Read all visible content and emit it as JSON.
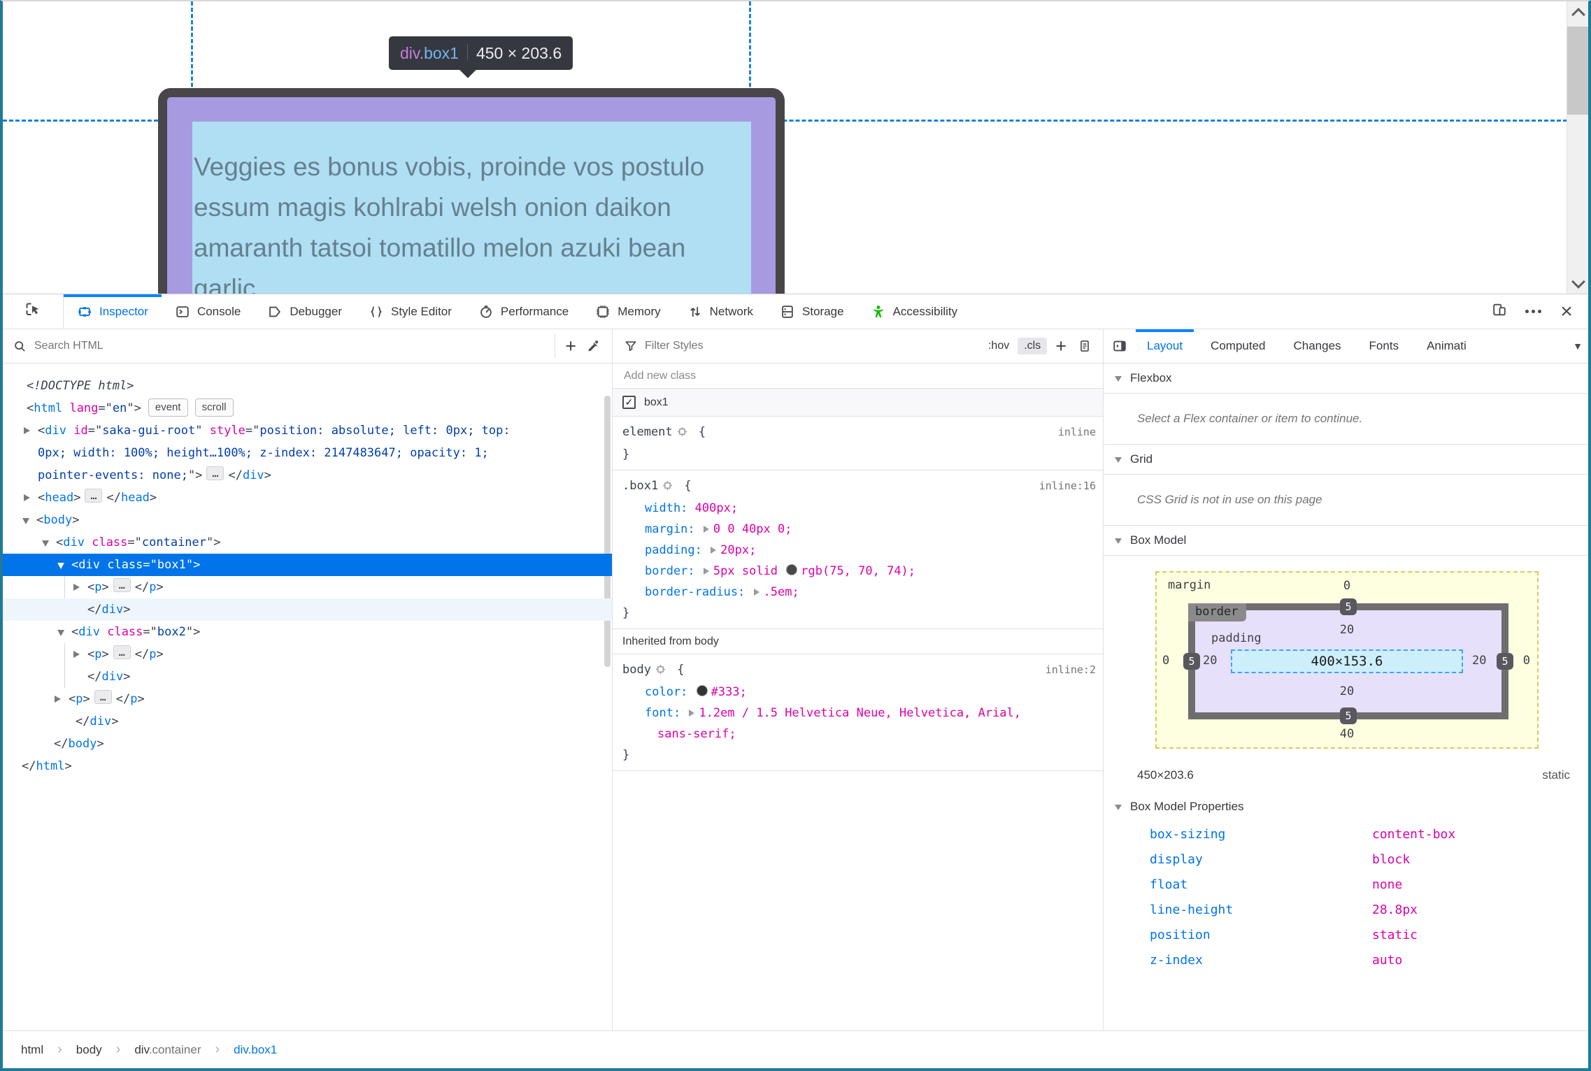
{
  "colors": {
    "accent": "#0074e8",
    "tab_indicator": "#0a84ff",
    "selection": "#0074e8",
    "accessibility_green": "#12bc00",
    "guide_blue": "#1b82d2",
    "window_edge": "#20799a",
    "box_border": "#4a4549",
    "box_padding_fill": "#a79ae0",
    "box_content_fill": "#b0def3"
  },
  "page": {
    "tooltip": {
      "tag": "div",
      "class": ".box1",
      "dims": "450 × 203.6"
    },
    "content_lines": [
      "Veggies es bonus vobis, proinde vos postulo",
      "essum magis kohlrabi welsh onion daikon",
      "amaranth tatsoi tomatillo melon azuki bean",
      "garlic."
    ]
  },
  "tabs_main": [
    {
      "label": "Inspector",
      "icon": "inspector-icon",
      "active": true
    },
    {
      "label": "Console",
      "icon": "console-icon"
    },
    {
      "label": "Debugger",
      "icon": "debugger-icon"
    },
    {
      "label": "Style Editor",
      "icon": "style-editor-icon"
    },
    {
      "label": "Performance",
      "icon": "performance-icon"
    },
    {
      "label": "Memory",
      "icon": "memory-icon"
    },
    {
      "label": "Network",
      "icon": "network-icon"
    },
    {
      "label": "Storage",
      "icon": "storage-icon"
    },
    {
      "label": "Accessibility",
      "icon": "accessibility-icon",
      "green": true
    }
  ],
  "toolbar": {
    "search_placeholder": "Search HTML",
    "filter_placeholder": "Filter Styles",
    "pseudo_label": ":hov",
    "cls_label": ".cls"
  },
  "sidebar_tabs": [
    {
      "label": "Layout",
      "active": true
    },
    {
      "label": "Computed"
    },
    {
      "label": "Changes"
    },
    {
      "label": "Fonts"
    },
    {
      "label": "Animati"
    }
  ],
  "markup_lines": [
    {
      "ind": 34,
      "segs": [
        [
          "dt",
          "<!DOCTYPE html>"
        ]
      ]
    },
    {
      "ind": 34,
      "segs": [
        [
          "p",
          "<"
        ],
        [
          "tag",
          "html"
        ],
        [
          "p",
          " "
        ],
        [
          "an",
          "lang"
        ],
        [
          "p",
          "=\""
        ],
        [
          "av",
          "en"
        ],
        [
          "p",
          "\">"
        ],
        [
          "badge",
          "event"
        ],
        [
          "badge",
          "scroll"
        ]
      ]
    },
    {
      "ind": 50,
      "exp": "r",
      "segs": [
        [
          "p",
          "<"
        ],
        [
          "tag",
          "div"
        ],
        [
          "p",
          " "
        ],
        [
          "an",
          "id"
        ],
        [
          "p",
          "=\""
        ],
        [
          "av",
          "saka-gui-root"
        ],
        [
          "p",
          "\" "
        ],
        [
          "an",
          "style"
        ],
        [
          "p",
          "=\""
        ],
        [
          "av",
          "position: absolute; left: 0px; top:"
        ]
      ]
    },
    {
      "ind": 50,
      "segs": [
        [
          "av",
          "0px; width: 100%; height…100%; z-index: 2147483647; opacity: 1;"
        ]
      ]
    },
    {
      "ind": 50,
      "segs": [
        [
          "av",
          "pointer-events: none;"
        ],
        [
          "p",
          "\">"
        ],
        [
          "dots",
          "…"
        ],
        [
          "p",
          "</"
        ],
        [
          "tag",
          "div"
        ],
        [
          "p",
          ">"
        ]
      ]
    },
    {
      "ind": 50,
      "exp": "r",
      "segs": [
        [
          "p",
          "<"
        ],
        [
          "tag",
          "head"
        ],
        [
          "p",
          ">"
        ],
        [
          "dots",
          "…"
        ],
        [
          "p",
          "</"
        ],
        [
          "tag",
          "head"
        ],
        [
          "p",
          ">"
        ]
      ]
    },
    {
      "ind": 48,
      "exp": "d",
      "segs": [
        [
          "p",
          "<"
        ],
        [
          "tag",
          "body"
        ],
        [
          "p",
          ">"
        ]
      ]
    },
    {
      "ind": 76,
      "exp": "d",
      "segs": [
        [
          "p",
          "<"
        ],
        [
          "tag",
          "div"
        ],
        [
          "p",
          " "
        ],
        [
          "an",
          "class"
        ],
        [
          "p",
          "=\""
        ],
        [
          "av",
          "container"
        ],
        [
          "p",
          "\">"
        ]
      ]
    },
    {
      "ind": 98,
      "exp": "d",
      "sel": true,
      "segs": [
        [
          "p",
          "<"
        ],
        [
          "tag",
          "div"
        ],
        [
          "p",
          " "
        ],
        [
          "an",
          "class"
        ],
        [
          "p",
          "=\""
        ],
        [
          "av",
          "box1"
        ],
        [
          "p",
          "\">"
        ]
      ]
    },
    {
      "ind": 121,
      "exp": "r",
      "segs": [
        [
          "p",
          "<"
        ],
        [
          "tag",
          "p"
        ],
        [
          "p",
          ">"
        ],
        [
          "dots",
          "…"
        ],
        [
          "p",
          "</"
        ],
        [
          "tag",
          "p"
        ],
        [
          "p",
          ">"
        ]
      ]
    },
    {
      "ind": 121,
      "shade": true,
      "segs": [
        [
          "p",
          "</"
        ],
        [
          "tag",
          "div"
        ],
        [
          "p",
          ">"
        ]
      ]
    },
    {
      "ind": 98,
      "exp": "d",
      "segs": [
        [
          "p",
          "<"
        ],
        [
          "tag",
          "div"
        ],
        [
          "p",
          " "
        ],
        [
          "an",
          "class"
        ],
        [
          "p",
          "=\""
        ],
        [
          "av",
          "box2"
        ],
        [
          "p",
          "\">"
        ]
      ]
    },
    {
      "ind": 121,
      "exp": "r",
      "segs": [
        [
          "p",
          "<"
        ],
        [
          "tag",
          "p"
        ],
        [
          "p",
          ">"
        ],
        [
          "dots",
          "…"
        ],
        [
          "p",
          "</"
        ],
        [
          "tag",
          "p"
        ],
        [
          "p",
          ">"
        ]
      ]
    },
    {
      "ind": 121,
      "segs": [
        [
          "p",
          "</"
        ],
        [
          "tag",
          "div"
        ],
        [
          "p",
          ">"
        ]
      ]
    },
    {
      "ind": 94,
      "exp": "r",
      "segs": [
        [
          "p",
          "<"
        ],
        [
          "tag",
          "p"
        ],
        [
          "p",
          ">"
        ],
        [
          "dots",
          "…"
        ],
        [
          "p",
          "</"
        ],
        [
          "tag",
          "p"
        ],
        [
          "p",
          ">"
        ]
      ]
    },
    {
      "ind": 104,
      "segs": [
        [
          "p",
          "</"
        ],
        [
          "tag",
          "div"
        ],
        [
          "p",
          ">"
        ]
      ]
    },
    {
      "ind": 73,
      "segs": [
        [
          "p",
          "</"
        ],
        [
          "tag",
          "body"
        ],
        [
          "p",
          ">"
        ]
      ]
    },
    {
      "ind": 27,
      "segs": [
        [
          "p",
          "</"
        ],
        [
          "tag",
          "html"
        ],
        [
          "p",
          ">"
        ]
      ]
    }
  ],
  "rules": {
    "add_class_placeholder": "Add new class",
    "class_toggle": {
      "label": "box1",
      "checked": true
    },
    "sections": [
      {
        "type": "rule",
        "selector": "element",
        "link": "inline",
        "props": []
      },
      {
        "type": "rule",
        "selector": ".box1",
        "link": "inline:16",
        "props": [
          {
            "name": "width",
            "expand": false,
            "parts": [
              [
                "t",
                "400px"
              ]
            ]
          },
          {
            "name": "margin",
            "expand": true,
            "parts": [
              [
                "t",
                "0 0 40px 0"
              ]
            ]
          },
          {
            "name": "padding",
            "expand": true,
            "parts": [
              [
                "t",
                "20px"
              ]
            ]
          },
          {
            "name": "border",
            "expand": true,
            "parts": [
              [
                "t",
                "5px solid "
              ],
              [
                "s",
                "#4B464A"
              ],
              [
                "t",
                "rgb(75, 70, 74)"
              ]
            ]
          },
          {
            "name": "border-radius",
            "expand": true,
            "parts": [
              [
                "t",
                ".5em"
              ]
            ]
          }
        ]
      },
      {
        "type": "header",
        "label": "Inherited from body"
      },
      {
        "type": "rule",
        "selector": "body",
        "link": "inline:2",
        "props": [
          {
            "name": "color",
            "expand": false,
            "parts": [
              [
                "s",
                "#333333"
              ],
              [
                "t",
                "#333"
              ]
            ]
          },
          {
            "name": "font",
            "expand": true,
            "parts": [
              [
                "t",
                "1.2em / 1.5 Helvetica Neue, Helvetica, Arial,"
              ]
            ],
            "wrap": "sans-serif"
          }
        ]
      }
    ]
  },
  "layout": {
    "flexbox": {
      "title": "Flexbox",
      "message": "Select a Flex container or item to continue."
    },
    "grid": {
      "title": "Grid",
      "message": "CSS Grid is not in use on this page"
    },
    "boxmodel": {
      "title": "Box Model",
      "margin_label": "margin",
      "border_label": "border",
      "padding_label": "padding",
      "margin": {
        "top": "0",
        "right": "0",
        "bottom": "40",
        "left": "0"
      },
      "border": {
        "top": "5",
        "right": "5",
        "bottom": "5",
        "left": "5"
      },
      "padding": {
        "top": "20",
        "right": "20",
        "bottom": "20",
        "left": "20"
      },
      "content": "400×153.6",
      "size": "450×203.6",
      "position": "static",
      "properties_title": "Box Model Properties",
      "properties": [
        [
          "box-sizing",
          "content-box"
        ],
        [
          "display",
          "block"
        ],
        [
          "float",
          "none"
        ],
        [
          "line-height",
          "28.8px"
        ],
        [
          "position",
          "static"
        ],
        [
          "z-index",
          "auto"
        ]
      ]
    }
  },
  "breadcrumb": [
    {
      "main": "html"
    },
    {
      "main": "body"
    },
    {
      "main": "div",
      "dim": ".container"
    },
    {
      "main": "div.box1",
      "active": true
    }
  ]
}
